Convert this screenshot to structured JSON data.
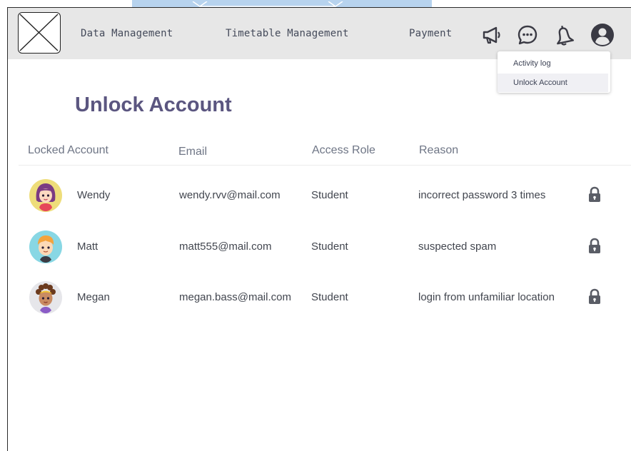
{
  "nav": {
    "links": [
      "Data Management",
      "Timetable Management",
      "Payment"
    ],
    "icons": [
      "megaphone-icon",
      "chat-icon",
      "bell-icon",
      "user-profile-icon"
    ]
  },
  "dropdown": {
    "items": [
      "Activity log",
      "Unlock Account"
    ],
    "active": "Unlock Account"
  },
  "page": {
    "title": "Unlock Account"
  },
  "table": {
    "columns": [
      "Locked Account",
      "Email",
      "Access Role",
      "Reason"
    ],
    "rows": [
      {
        "name": "Wendy",
        "email": "wendy.rvv@mail.com",
        "role": "Student",
        "reason": "incorrect password 3 times",
        "avatar": "girl-avatar-purple-hair"
      },
      {
        "name": "Matt",
        "email": "matt555@mail.com",
        "role": "Student",
        "reason": "suspected spam",
        "avatar": "boy-avatar-orange-hair"
      },
      {
        "name": "Megan",
        "email": "megan.bass@mail.com",
        "role": "Student",
        "reason": "login from unfamiliar location",
        "avatar": "girl-avatar-curly-hair"
      }
    ]
  },
  "colors": {
    "navbar_bg": "#e7e7e7",
    "title": "#5b5680",
    "header_text": "#6e7585",
    "lock_icon": "#5a5d66",
    "artifact_blue": "#b7d3ee"
  }
}
